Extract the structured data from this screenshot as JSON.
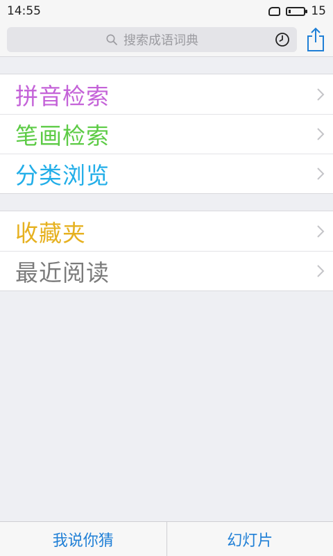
{
  "status_bar": {
    "time": "14:55",
    "battery_level": "15",
    "battery_fraction": 0.15
  },
  "search": {
    "placeholder": "搜索成语词典",
    "icons": [
      "search-icon",
      "history-clock-icon",
      "share-icon"
    ]
  },
  "menu_groups": [
    {
      "items": [
        {
          "label": "拼音检索",
          "color": "#c462d8"
        },
        {
          "label": "笔画检索",
          "color": "#5ccb45"
        },
        {
          "label": "分类浏览",
          "color": "#22aee8"
        }
      ]
    },
    {
      "items": [
        {
          "label": "收藏夹",
          "color": "#e6b120"
        },
        {
          "label": "最近阅读",
          "color": "#7b7b7b"
        }
      ]
    }
  ],
  "tabbar": {
    "left_label": "我说你猜",
    "right_label": "幻灯片",
    "color": "#1f7fd6"
  },
  "colors": {
    "background": "#eeeff3",
    "chevron": "#c4c4c8",
    "accent": "#1f7fd6"
  }
}
